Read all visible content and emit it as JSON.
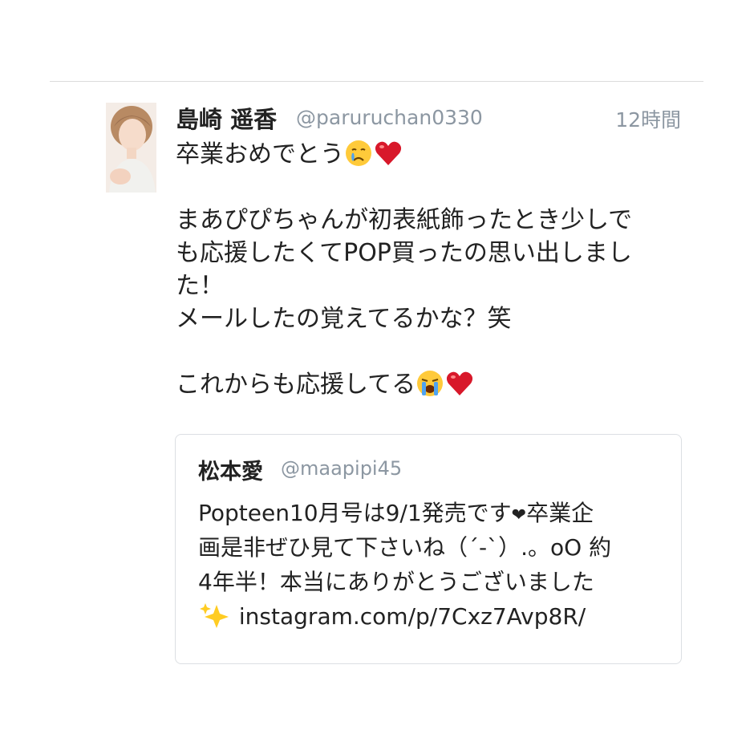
{
  "tweet": {
    "author_name": "島崎 遥香",
    "handle": "@paruruchan0330",
    "timestamp": "12時間",
    "lines": [
      "卒業おめでとう",
      "",
      "まあぴぴちゃんが初表紙飾ったとき少しで",
      "も応援したくてPOP買ったの思い出しまし",
      "た！",
      "メールしたの覚えてるかな？笑",
      "",
      "これからも応援してる"
    ],
    "emojis": {
      "line1": [
        "crying-face-icon",
        "red-heart-icon"
      ],
      "line8": [
        "loudly-crying-face-icon",
        "red-heart-icon"
      ]
    }
  },
  "quoted_tweet": {
    "author_name": "松本愛",
    "handle": "@maapipi45",
    "line1_a": "Popteen10月号は9/1発売です",
    "heart": "❤",
    "line1_b": "卒業企",
    "line2": "画是非ぜひ見て下さいね（´-`）.。oO 約",
    "line3": "4年半！本当にありがとうございました",
    "link": "instagram.com/p/7Cxz7Avp8R/",
    "sparkles_icon": "sparkles-icon"
  },
  "colors": {
    "text": "#222222",
    "secondary": "#8c97a2",
    "divider": "#dcdcdc",
    "card_border": "#dcdfe3",
    "heart": "#d8182a",
    "emoji_face": "#ffca3a"
  }
}
